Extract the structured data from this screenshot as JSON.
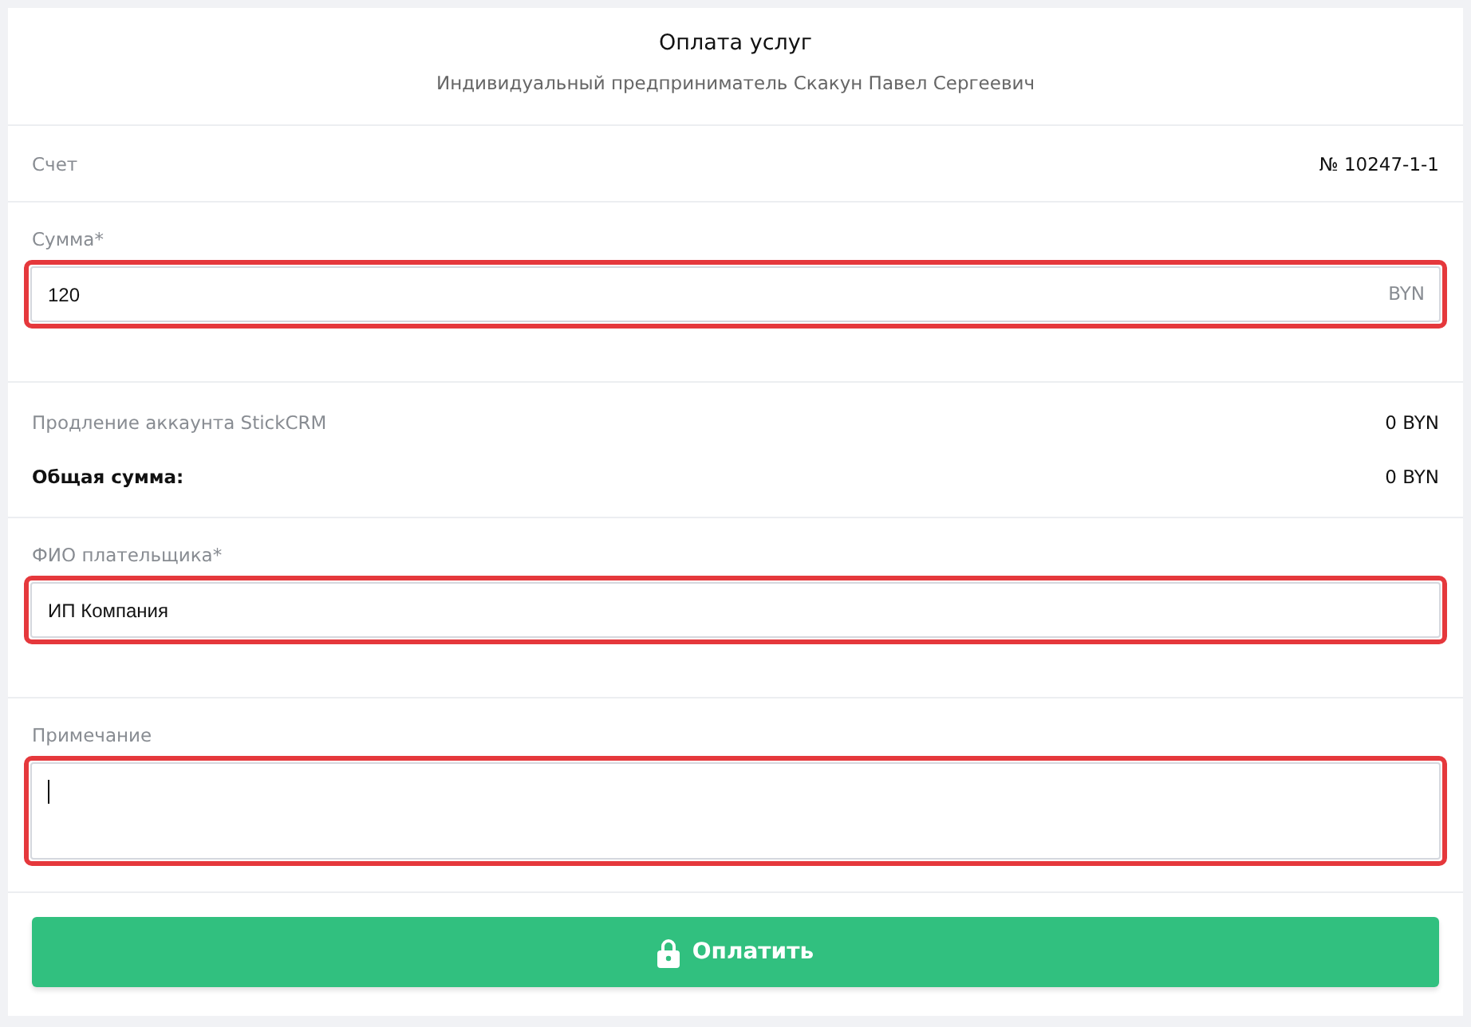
{
  "header": {
    "title": "Оплата услуг",
    "subtitle": "Индивидуальный предприниматель Скакун Павел Сергеевич"
  },
  "invoice": {
    "label": "Счет",
    "value": "№ 10247-1-1"
  },
  "amount": {
    "label": "Сумма*",
    "value": "120",
    "suffix": "BYN",
    "highlighted": true
  },
  "summary": [
    {
      "label": "Продление аккаунта StickCRM",
      "value": "0 BYN",
      "kind": "item"
    },
    {
      "label": "Общая сумма:",
      "value": "0 BYN",
      "kind": "total"
    }
  ],
  "payer": {
    "label": "ФИО плательщика*",
    "value": "ИП Компания",
    "highlighted": true
  },
  "note": {
    "label": "Примечание",
    "focused": true,
    "highlighted": true
  },
  "pay_button": {
    "label": "Оплатить"
  }
}
